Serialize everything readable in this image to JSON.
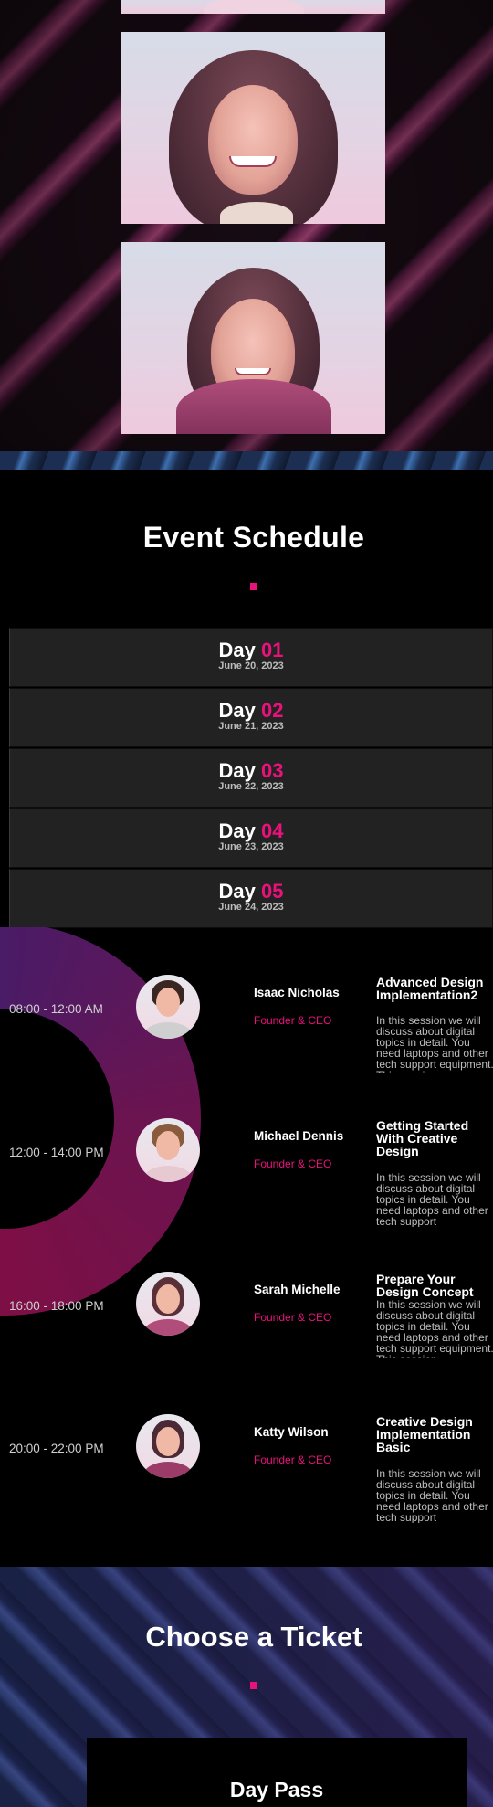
{
  "schedule": {
    "title": "Event Schedule",
    "days": [
      {
        "label": "Day",
        "number": "01",
        "date": "June 20, 2023"
      },
      {
        "label": "Day",
        "number": "02",
        "date": "June 21, 2023"
      },
      {
        "label": "Day",
        "number": "03",
        "date": "June 22, 2023"
      },
      {
        "label": "Day",
        "number": "04",
        "date": "June 23, 2023"
      },
      {
        "label": "Day",
        "number": "05",
        "date": "June 24, 2023"
      }
    ],
    "sessions": [
      {
        "time": "08:00 - 12:00 AM",
        "speaker": "Isaac Nicholas",
        "role": "Founder & CEO",
        "title": "Advanced Design Implementation2",
        "description": "In this session we will discuss about digital topics in detail. You need laptops and other tech support equipment. This session"
      },
      {
        "time": "12:00 - 14:00 PM",
        "speaker": "Michael Dennis",
        "role": "Founder & CEO",
        "title": "Getting Started With Creative Design",
        "description": "In this session we will discuss about digital topics in detail. You need laptops and other tech support"
      },
      {
        "time": "16:00 - 18:00 PM",
        "speaker": "Sarah Michelle",
        "role": "Founder & CEO",
        "title": "Prepare Your Design Concept",
        "description": "In this session we will discuss about digital topics in detail. You need laptops and other tech support equipment. This session"
      },
      {
        "time": "20:00 - 22:00 PM",
        "speaker": "Katty Wilson",
        "role": "Founder & CEO",
        "title": "Creative Design Implementation Basic",
        "description": "In this session we will discuss about digital topics in detail. You need laptops and other tech support"
      }
    ]
  },
  "tickets": {
    "title": "Choose a Ticket",
    "first_pass": "Day Pass"
  },
  "colors": {
    "accent": "#e8127a",
    "day_tab_bg": "#222222"
  }
}
